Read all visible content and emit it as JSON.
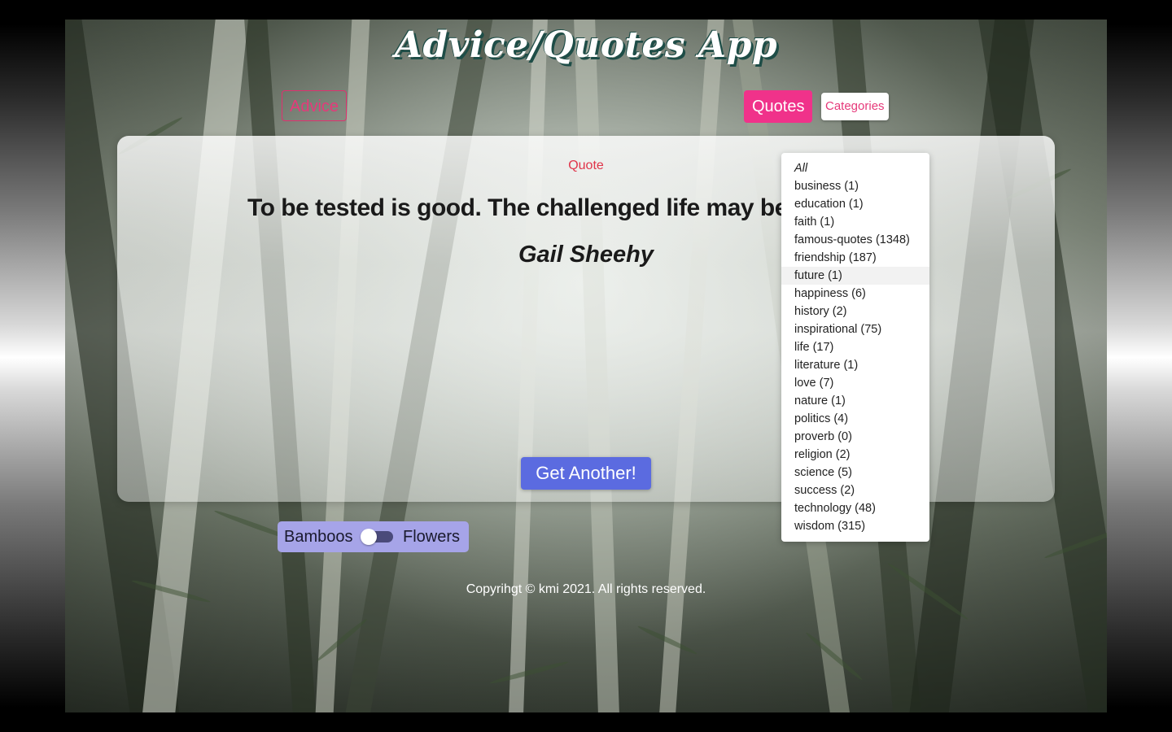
{
  "app": {
    "title": "Advice/Quotes App"
  },
  "nav": {
    "advice_label": "Advice",
    "quotes_label": "Quotes",
    "categories_label": "Categories"
  },
  "card": {
    "label": "Quote",
    "quote_text": "To be tested is good. The challenged life may be the b",
    "author": "Gail Sheehy",
    "get_another_label": "Get Another!"
  },
  "categories": [
    {
      "label": "All"
    },
    {
      "label": "business (1)"
    },
    {
      "label": "education (1)"
    },
    {
      "label": "faith (1)"
    },
    {
      "label": "famous-quotes (1348)"
    },
    {
      "label": "friendship (187)"
    },
    {
      "label": "future (1)"
    },
    {
      "label": "happiness (6)"
    },
    {
      "label": "history (2)"
    },
    {
      "label": "inspirational (75)"
    },
    {
      "label": "life (17)"
    },
    {
      "label": "literature (1)"
    },
    {
      "label": "love (7)"
    },
    {
      "label": "nature (1)"
    },
    {
      "label": "politics (4)"
    },
    {
      "label": "proverb (0)"
    },
    {
      "label": "religion (2)"
    },
    {
      "label": "science (5)"
    },
    {
      "label": "success (2)"
    },
    {
      "label": "technology (48)"
    },
    {
      "label": "wisdom (315)"
    }
  ],
  "background_toggle": {
    "left_label": "Bamboos",
    "right_label": "Flowers",
    "selected": "Bamboos"
  },
  "footer": {
    "text": "Copyrihgt © kmi 2021. All rights reserved."
  },
  "colors": {
    "accent_pink": "#f0328a",
    "button_blue": "#5b6be0",
    "toggle_bg": "#a6a4e8",
    "title_shadow": "#1e4d47"
  }
}
